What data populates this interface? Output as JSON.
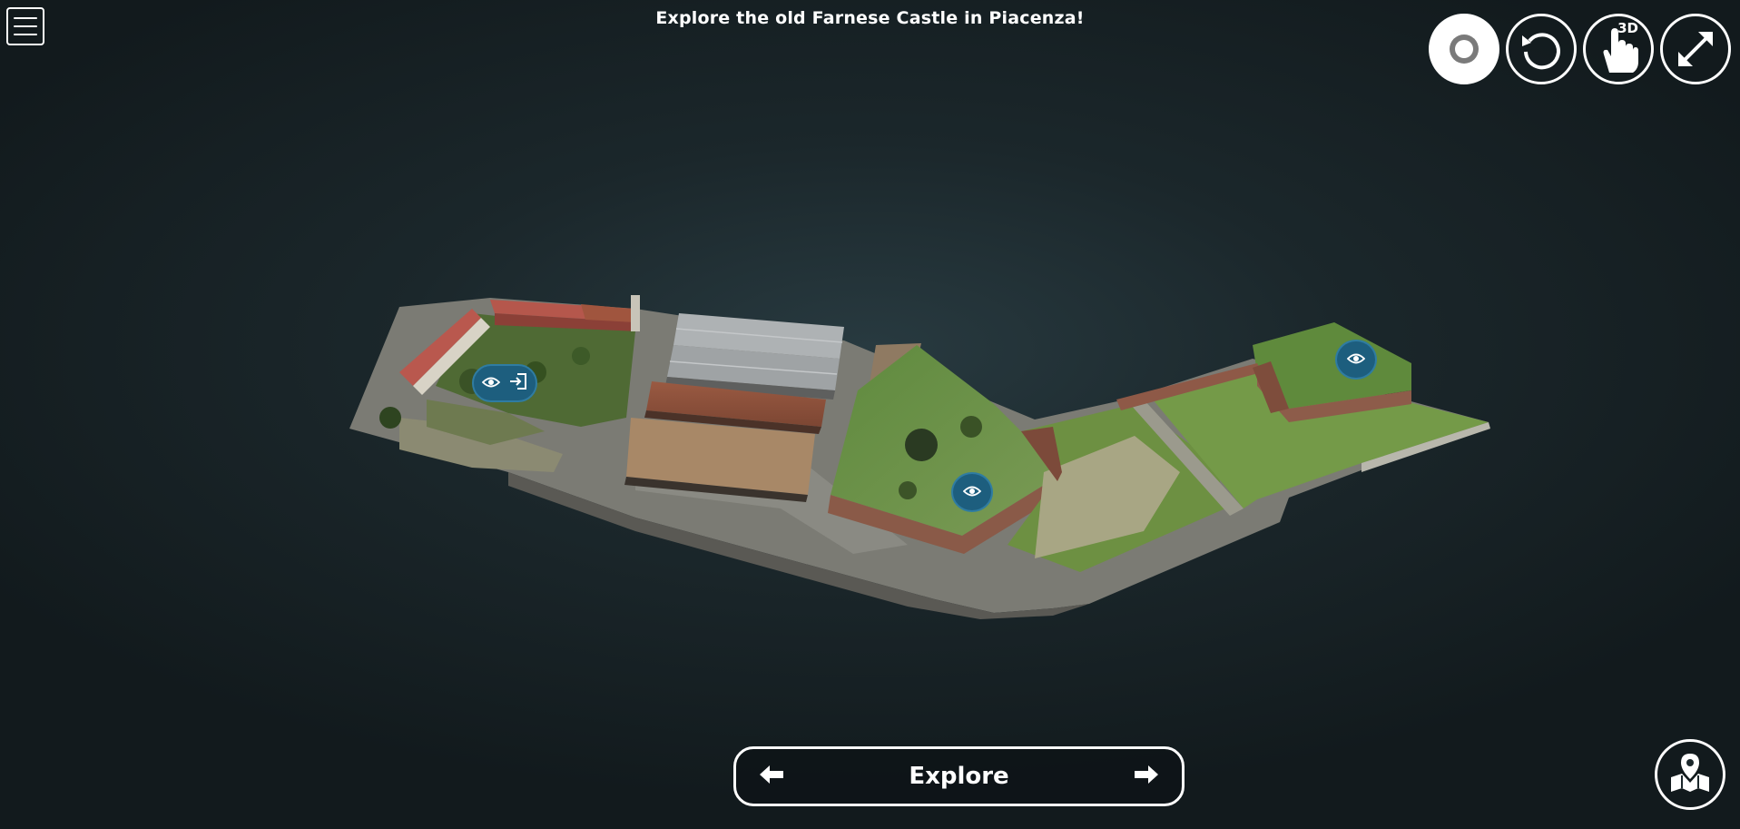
{
  "app": {
    "title": "Explore the old Farnese Castle in Piacenza!"
  },
  "toolbar": {
    "buttons": [
      {
        "icon": "camera-icon"
      },
      {
        "icon": "reset-view-icon"
      },
      {
        "icon": "3d-touch-icon",
        "badge": "3D"
      },
      {
        "icon": "fullscreen-icon"
      }
    ]
  },
  "navigation": {
    "label": "Explore",
    "prev_icon": "arrow-left-icon",
    "next_icon": "arrow-right-icon"
  },
  "hotspots": [
    {
      "icons": [
        "eye-icon",
        "enter-icon"
      ]
    },
    {
      "icons": [
        "eye-icon"
      ]
    },
    {
      "icons": [
        "eye-icon"
      ]
    }
  ],
  "map_button": {
    "icon": "map-pin-icon"
  },
  "colors": {
    "hotspot_fill": "#1d5e7e",
    "background": "#1b272b",
    "controls": "#ffffff"
  }
}
